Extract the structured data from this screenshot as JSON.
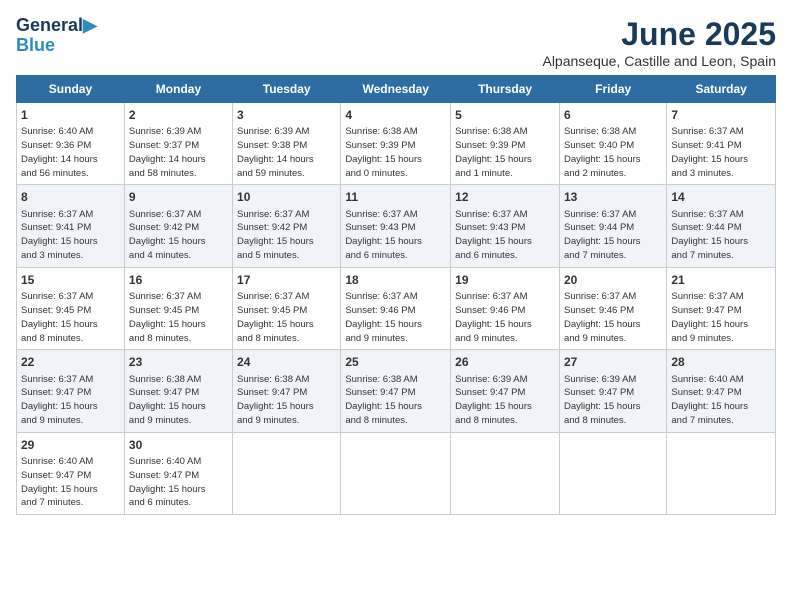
{
  "logo": {
    "line1": "General",
    "line2": "Blue"
  },
  "title": "June 2025",
  "subtitle": "Alpanseque, Castille and Leon, Spain",
  "days_of_week": [
    "Sunday",
    "Monday",
    "Tuesday",
    "Wednesday",
    "Thursday",
    "Friday",
    "Saturday"
  ],
  "weeks": [
    [
      {
        "day": 1,
        "info": "Sunrise: 6:40 AM\nSunset: 9:36 PM\nDaylight: 14 hours\nand 56 minutes."
      },
      {
        "day": 2,
        "info": "Sunrise: 6:39 AM\nSunset: 9:37 PM\nDaylight: 14 hours\nand 58 minutes."
      },
      {
        "day": 3,
        "info": "Sunrise: 6:39 AM\nSunset: 9:38 PM\nDaylight: 14 hours\nand 59 minutes."
      },
      {
        "day": 4,
        "info": "Sunrise: 6:38 AM\nSunset: 9:39 PM\nDaylight: 15 hours\nand 0 minutes."
      },
      {
        "day": 5,
        "info": "Sunrise: 6:38 AM\nSunset: 9:39 PM\nDaylight: 15 hours\nand 1 minute."
      },
      {
        "day": 6,
        "info": "Sunrise: 6:38 AM\nSunset: 9:40 PM\nDaylight: 15 hours\nand 2 minutes."
      },
      {
        "day": 7,
        "info": "Sunrise: 6:37 AM\nSunset: 9:41 PM\nDaylight: 15 hours\nand 3 minutes."
      }
    ],
    [
      {
        "day": 8,
        "info": "Sunrise: 6:37 AM\nSunset: 9:41 PM\nDaylight: 15 hours\nand 3 minutes."
      },
      {
        "day": 9,
        "info": "Sunrise: 6:37 AM\nSunset: 9:42 PM\nDaylight: 15 hours\nand 4 minutes."
      },
      {
        "day": 10,
        "info": "Sunrise: 6:37 AM\nSunset: 9:42 PM\nDaylight: 15 hours\nand 5 minutes."
      },
      {
        "day": 11,
        "info": "Sunrise: 6:37 AM\nSunset: 9:43 PM\nDaylight: 15 hours\nand 6 minutes."
      },
      {
        "day": 12,
        "info": "Sunrise: 6:37 AM\nSunset: 9:43 PM\nDaylight: 15 hours\nand 6 minutes."
      },
      {
        "day": 13,
        "info": "Sunrise: 6:37 AM\nSunset: 9:44 PM\nDaylight: 15 hours\nand 7 minutes."
      },
      {
        "day": 14,
        "info": "Sunrise: 6:37 AM\nSunset: 9:44 PM\nDaylight: 15 hours\nand 7 minutes."
      }
    ],
    [
      {
        "day": 15,
        "info": "Sunrise: 6:37 AM\nSunset: 9:45 PM\nDaylight: 15 hours\nand 8 minutes."
      },
      {
        "day": 16,
        "info": "Sunrise: 6:37 AM\nSunset: 9:45 PM\nDaylight: 15 hours\nand 8 minutes."
      },
      {
        "day": 17,
        "info": "Sunrise: 6:37 AM\nSunset: 9:45 PM\nDaylight: 15 hours\nand 8 minutes."
      },
      {
        "day": 18,
        "info": "Sunrise: 6:37 AM\nSunset: 9:46 PM\nDaylight: 15 hours\nand 9 minutes."
      },
      {
        "day": 19,
        "info": "Sunrise: 6:37 AM\nSunset: 9:46 PM\nDaylight: 15 hours\nand 9 minutes."
      },
      {
        "day": 20,
        "info": "Sunrise: 6:37 AM\nSunset: 9:46 PM\nDaylight: 15 hours\nand 9 minutes."
      },
      {
        "day": 21,
        "info": "Sunrise: 6:37 AM\nSunset: 9:47 PM\nDaylight: 15 hours\nand 9 minutes."
      }
    ],
    [
      {
        "day": 22,
        "info": "Sunrise: 6:37 AM\nSunset: 9:47 PM\nDaylight: 15 hours\nand 9 minutes."
      },
      {
        "day": 23,
        "info": "Sunrise: 6:38 AM\nSunset: 9:47 PM\nDaylight: 15 hours\nand 9 minutes."
      },
      {
        "day": 24,
        "info": "Sunrise: 6:38 AM\nSunset: 9:47 PM\nDaylight: 15 hours\nand 9 minutes."
      },
      {
        "day": 25,
        "info": "Sunrise: 6:38 AM\nSunset: 9:47 PM\nDaylight: 15 hours\nand 8 minutes."
      },
      {
        "day": 26,
        "info": "Sunrise: 6:39 AM\nSunset: 9:47 PM\nDaylight: 15 hours\nand 8 minutes."
      },
      {
        "day": 27,
        "info": "Sunrise: 6:39 AM\nSunset: 9:47 PM\nDaylight: 15 hours\nand 8 minutes."
      },
      {
        "day": 28,
        "info": "Sunrise: 6:40 AM\nSunset: 9:47 PM\nDaylight: 15 hours\nand 7 minutes."
      }
    ],
    [
      {
        "day": 29,
        "info": "Sunrise: 6:40 AM\nSunset: 9:47 PM\nDaylight: 15 hours\nand 7 minutes."
      },
      {
        "day": 30,
        "info": "Sunrise: 6:40 AM\nSunset: 9:47 PM\nDaylight: 15 hours\nand 6 minutes."
      },
      null,
      null,
      null,
      null,
      null
    ]
  ]
}
